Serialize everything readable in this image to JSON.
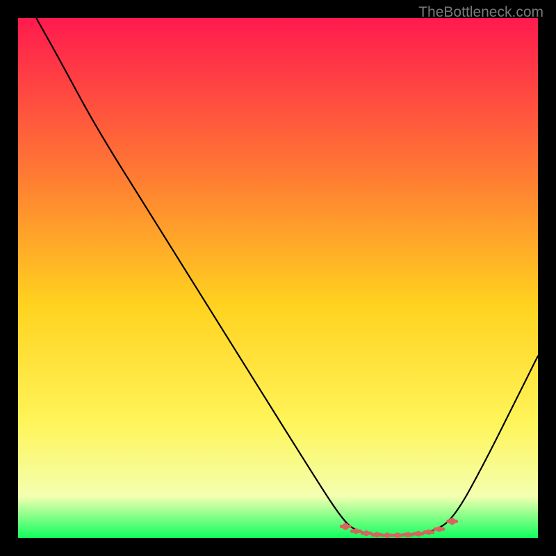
{
  "watermark": "TheBottleneck.com",
  "chart_data": {
    "type": "line",
    "title": "",
    "xlabel": "",
    "ylabel": "",
    "xlim": [
      0,
      100
    ],
    "ylim": [
      0,
      100
    ],
    "gradient_colors": {
      "top": "#ff1a4e",
      "upper_mid": "#ff7a33",
      "mid": "#ffd21f",
      "lower_mid": "#fff55a",
      "lower": "#f3ffb0",
      "bottom": "#11ff5e"
    },
    "series": [
      {
        "name": "bottleneck-curve",
        "color": "#000000",
        "points": [
          {
            "x": 3.5,
            "y": 100
          },
          {
            "x": 8,
            "y": 92
          },
          {
            "x": 15,
            "y": 79
          },
          {
            "x": 25,
            "y": 63
          },
          {
            "x": 35,
            "y": 47
          },
          {
            "x": 45,
            "y": 31
          },
          {
            "x": 55,
            "y": 15
          },
          {
            "x": 62,
            "y": 4
          },
          {
            "x": 65,
            "y": 1.2
          },
          {
            "x": 70,
            "y": 0.5
          },
          {
            "x": 75,
            "y": 0.5
          },
          {
            "x": 80,
            "y": 1.2
          },
          {
            "x": 84,
            "y": 4
          },
          {
            "x": 90,
            "y": 15
          },
          {
            "x": 96,
            "y": 27
          },
          {
            "x": 100,
            "y": 35
          }
        ]
      }
    ],
    "markers": {
      "name": "flat-region-dots",
      "color": "#d8635f",
      "points": [
        {
          "x": 63,
          "y": 2.2
        },
        {
          "x": 65,
          "y": 1.3
        },
        {
          "x": 67,
          "y": 0.9
        },
        {
          "x": 69,
          "y": 0.6
        },
        {
          "x": 71,
          "y": 0.5
        },
        {
          "x": 73,
          "y": 0.5
        },
        {
          "x": 75,
          "y": 0.6
        },
        {
          "x": 77,
          "y": 0.8
        },
        {
          "x": 79,
          "y": 1.1
        },
        {
          "x": 81,
          "y": 1.7
        },
        {
          "x": 83.5,
          "y": 3.2
        }
      ]
    }
  }
}
